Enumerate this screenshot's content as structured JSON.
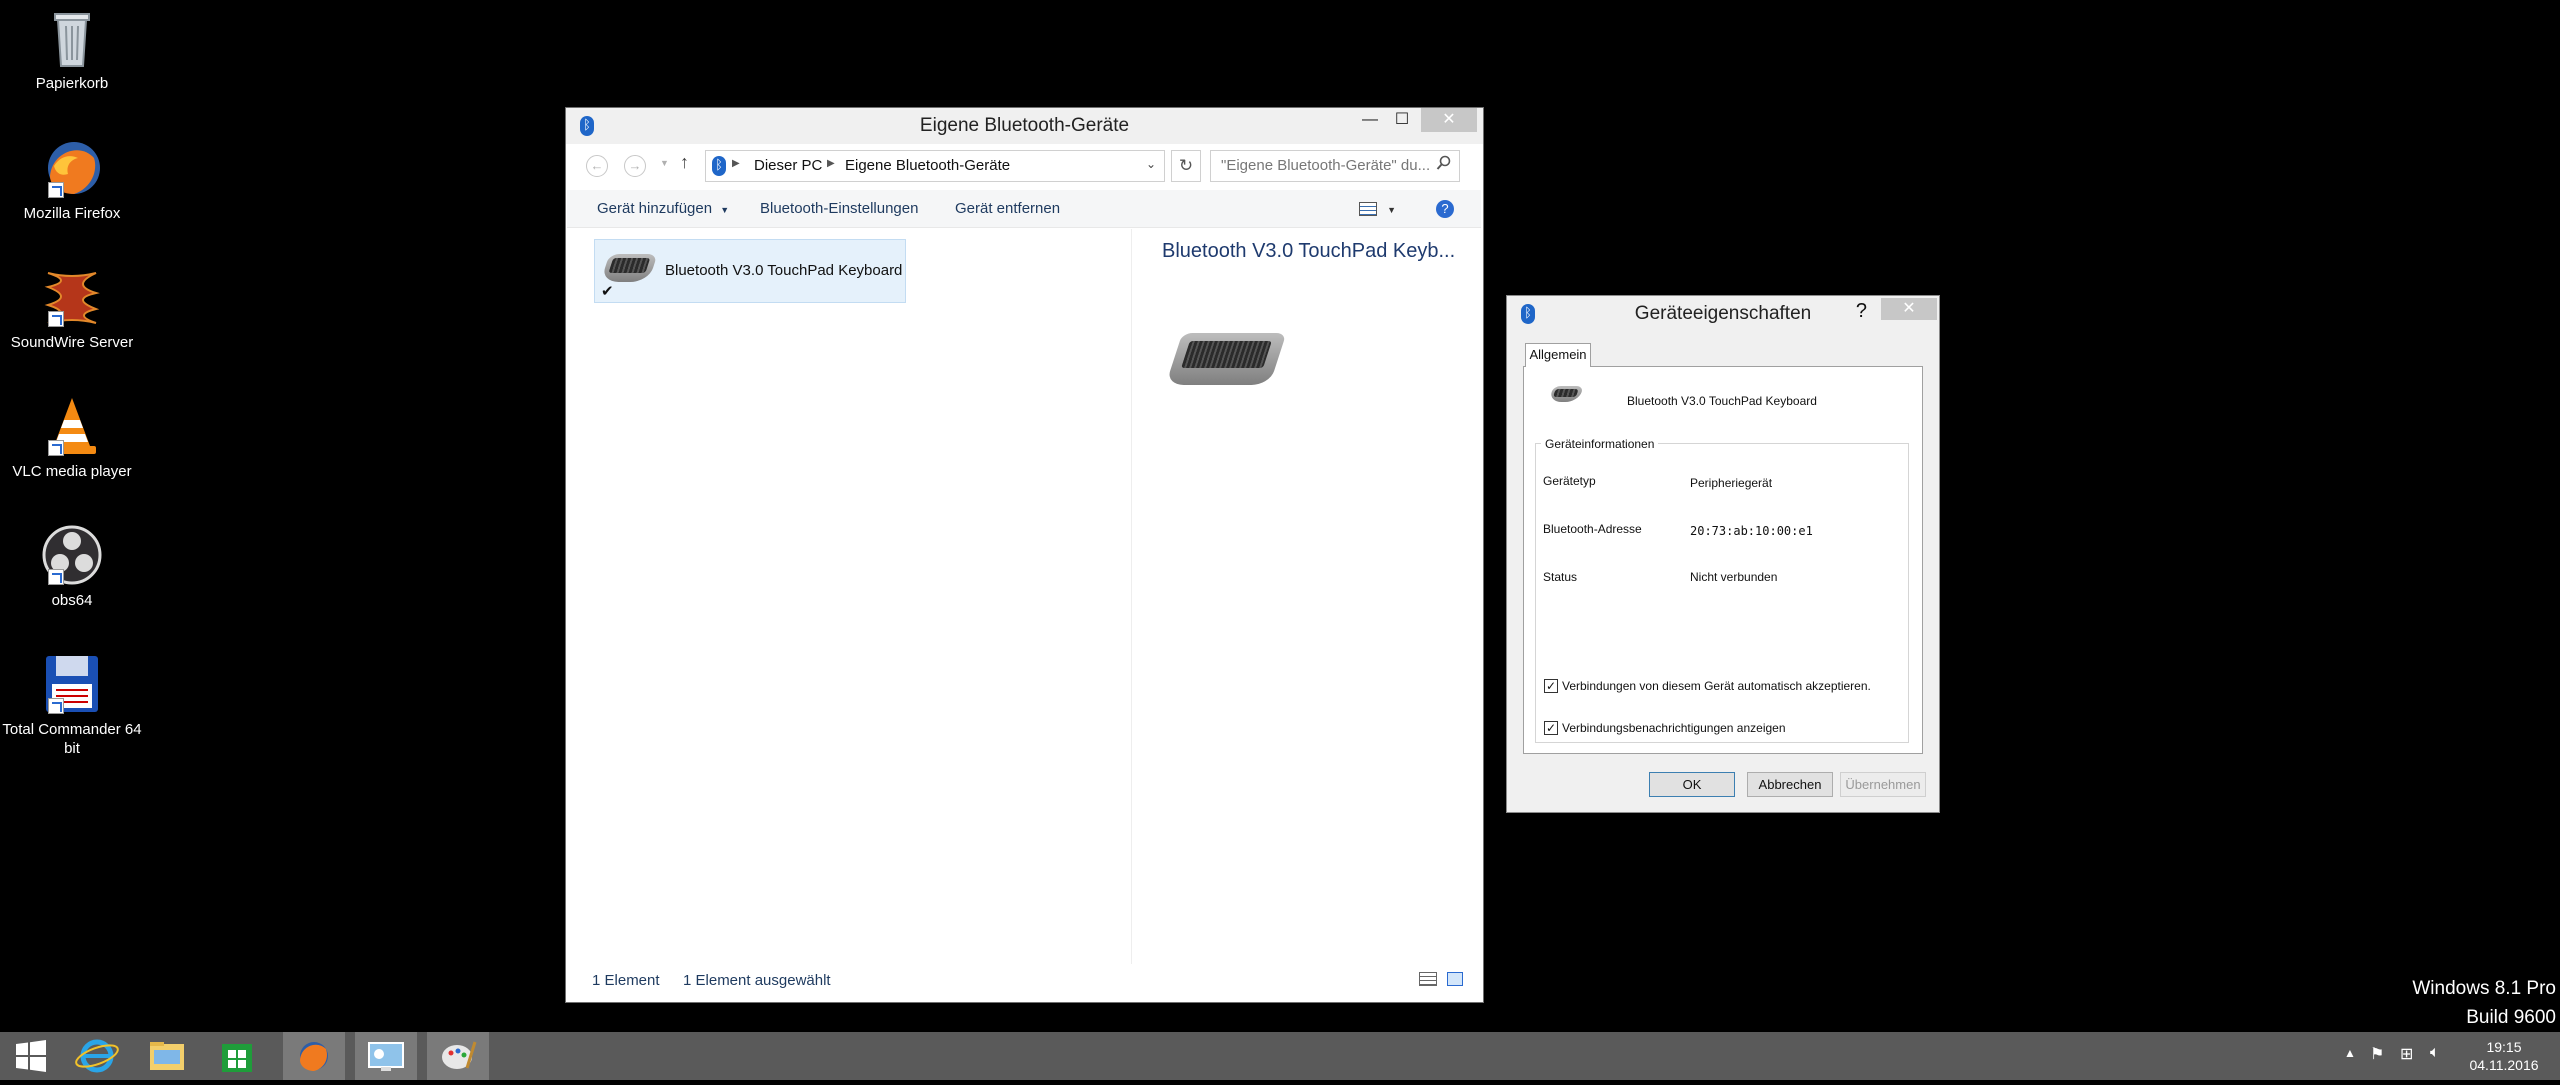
{
  "desktop": {
    "icons": [
      {
        "label": "Papierkorb",
        "icon": "recycle-bin-icon"
      },
      {
        "label": "Mozilla Firefox",
        "icon": "firefox-icon"
      },
      {
        "label": "SoundWire Server",
        "icon": "soundwire-icon"
      },
      {
        "label": "VLC media player",
        "icon": "vlc-icon"
      },
      {
        "label": "obs64",
        "icon": "obs-icon"
      },
      {
        "label": "Total Commander 64 bit",
        "icon": "total-commander-icon"
      }
    ],
    "watermark_line1": "Windows 8.1 Pro",
    "watermark_line2": "Build 9600"
  },
  "explorer": {
    "title": "Eigene Bluetooth-Geräte",
    "breadcrumb": [
      "Dieser PC",
      "Eigene Bluetooth-Geräte"
    ],
    "search_placeholder": "\"Eigene Bluetooth-Geräte\" du...",
    "toolbar": {
      "add_device": "Gerät hinzufügen",
      "bt_settings": "Bluetooth-Einstellungen",
      "remove_device": "Gerät entfernen"
    },
    "items": [
      {
        "name": "Bluetooth V3.0 TouchPad Keyboard"
      }
    ],
    "detail_title": "Bluetooth V3.0 TouchPad Keyb...",
    "status": {
      "count": "1 Element",
      "selected": "1 Element ausgewählt"
    }
  },
  "properties": {
    "title": "Geräteeigenschaften",
    "help": "?",
    "tab": "Allgemein",
    "device_name": "Bluetooth V3.0 TouchPad Keyboard",
    "group_title": "Geräteinformationen",
    "rows": [
      {
        "label": "Gerätetyp",
        "value": "Peripheriegerät"
      },
      {
        "label": "Bluetooth-Adresse",
        "value": "20:73:ab:10:00:e1"
      },
      {
        "label": "Status",
        "value": "Nicht verbunden"
      }
    ],
    "check_auto_accept": "Verbindungen von diesem Gerät automatisch akzeptieren.",
    "check_notifications": "Verbindungsbenachrichtigungen anzeigen",
    "ok": "OK",
    "cancel": "Abbrechen",
    "apply": "Übernehmen"
  },
  "taskbar": {
    "time": "19:15",
    "date": "04.11.2016"
  }
}
